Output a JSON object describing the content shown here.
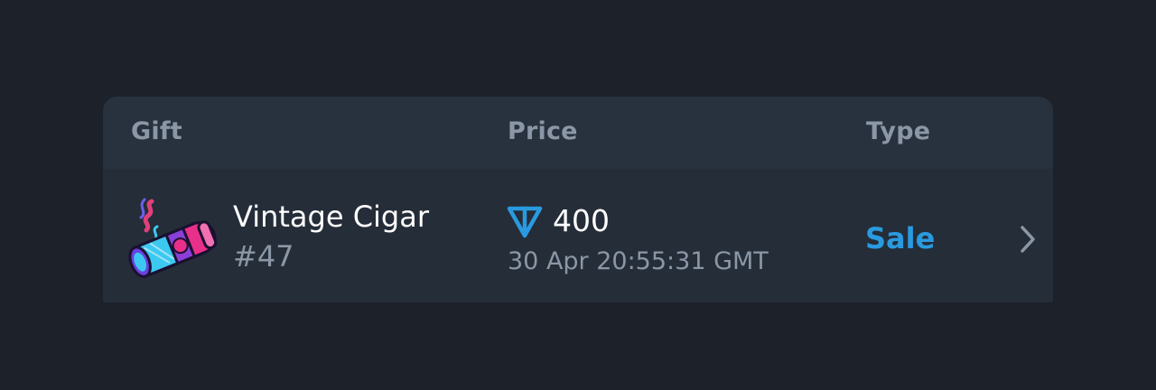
{
  "table": {
    "columns": [
      "Gift",
      "Price",
      "Type"
    ]
  },
  "row": {
    "gift_name": "Vintage Cigar",
    "gift_number": "#47",
    "price": "400",
    "date": "30 Apr 20:55:31 GMT",
    "type": "Sale",
    "gift_icon": "cigar-illustration",
    "currency_icon": "ton-icon",
    "chevron_icon": "chevron-right-icon"
  },
  "colors": {
    "background": "#1d2129",
    "card": "#242d38",
    "header": "#28323e",
    "accent": "#2a9ae0",
    "muted_text": "#8b97a6"
  }
}
